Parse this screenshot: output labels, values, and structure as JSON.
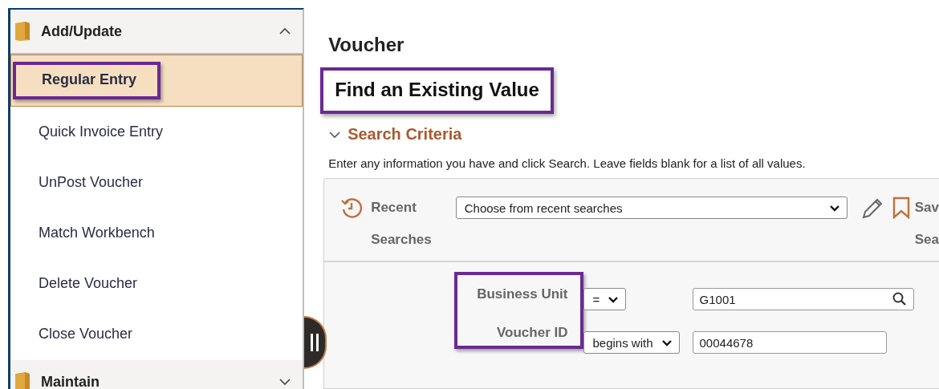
{
  "sidebar": {
    "groups": [
      {
        "label": "Add/Update",
        "expanded": true,
        "items": [
          {
            "label": "Regular Entry",
            "selected": true,
            "highlighted": true
          },
          {
            "label": "Quick Invoice Entry",
            "selected": false,
            "highlighted": false
          },
          {
            "label": "UnPost Voucher",
            "selected": false,
            "highlighted": false
          },
          {
            "label": "Match Workbench",
            "selected": false,
            "highlighted": false
          },
          {
            "label": "Delete Voucher",
            "selected": false,
            "highlighted": false
          },
          {
            "label": "Close Voucher",
            "selected": false,
            "highlighted": false
          }
        ]
      },
      {
        "label": "Maintain",
        "expanded": false
      }
    ]
  },
  "page": {
    "title": "Voucher",
    "subtitle": "Find an Existing Value",
    "subtitle_highlighted": true,
    "section": {
      "title": "Search Criteria",
      "expanded": true,
      "instructions": "Enter any information you have and click Search. Leave fields blank for a list of all values.",
      "recent": {
        "label_1": "Recent",
        "label_2": "Searches",
        "placeholder": "Choose from recent searches"
      },
      "save": {
        "label_1": "Sav",
        "label_2": "Sea"
      },
      "labels_highlighted": true,
      "fields": [
        {
          "label": "Business Unit",
          "operator": "=",
          "value": "G1001",
          "lookup": true
        },
        {
          "label": "Voucher ID",
          "operator": "begins with",
          "value": "00044678",
          "lookup": false
        }
      ]
    }
  }
}
